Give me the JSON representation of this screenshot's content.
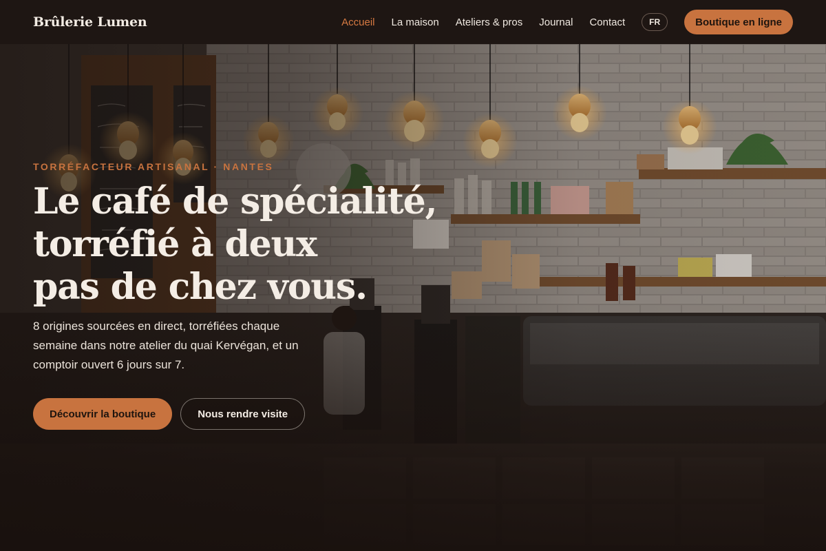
{
  "nav": {
    "brand": "Brûlerie Lumen",
    "links": [
      {
        "label": "Accueil",
        "active": true
      },
      {
        "label": "La maison"
      },
      {
        "label": "Ateliers & pros"
      },
      {
        "label": "Journal"
      },
      {
        "label": "Contact"
      }
    ],
    "language": "FR",
    "shop_button": "Boutique en ligne"
  },
  "hero": {
    "eyebrow": "Torréfacteur artisanal · Nantes",
    "headline": [
      "Le café de spécialité,",
      "torréfié à deux",
      "pas de chez vous."
    ],
    "lead": "8 origines sourcées en direct, torréfiées chaque semaine dans notre atelier du quai Kervégan, et un comptoir ouvert 6 jours sur 7.",
    "primary_cta": "Découvrir la boutique",
    "secondary_cta": "Nous rendre visite",
    "background_image": "café counter interior with pendant bulbs, chalkboard menu and espresso machine"
  },
  "colors": {
    "accent": "#c8733f",
    "nav_bg": "#1e1613",
    "text_light": "#f4ede5"
  }
}
